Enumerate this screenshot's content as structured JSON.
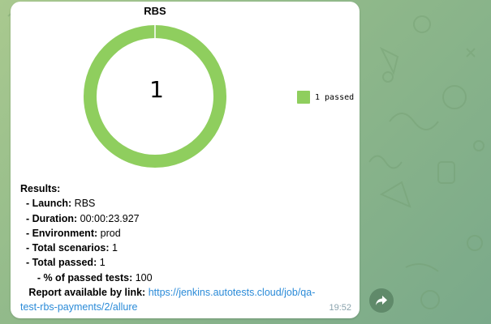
{
  "chart": {
    "title": "RBS",
    "center_value": "1",
    "legend_label": "1 passed",
    "color": "#8fce5e"
  },
  "chart_data": {
    "type": "pie",
    "title": "RBS",
    "categories": [
      "passed"
    ],
    "values": [
      1
    ],
    "legend": [
      "1 passed"
    ],
    "legend_placement": "right"
  },
  "message": {
    "results_heading": "Results:",
    "lines": [
      {
        "label": "  - Launch:",
        "value": " RBS"
      },
      {
        "label": "  - Duration:",
        "value": " 00:00:23.927"
      },
      {
        "label": "  - Environment:",
        "value": " prod"
      },
      {
        "label": "  - Total scenarios:",
        "value": " 1"
      },
      {
        "label": "  - Total passed:",
        "value": " 1"
      },
      {
        "label": "      - % of passed tests:",
        "value": " 100"
      }
    ],
    "report_label": "   Report available by link: ",
    "report_link_line1": "https://jenkins.autotests.cloud/job/qa-",
    "report_link_line2": "test-rbs-payments/2/allure",
    "time": "19:52"
  },
  "icons": {
    "share": "share-arrow-icon"
  }
}
